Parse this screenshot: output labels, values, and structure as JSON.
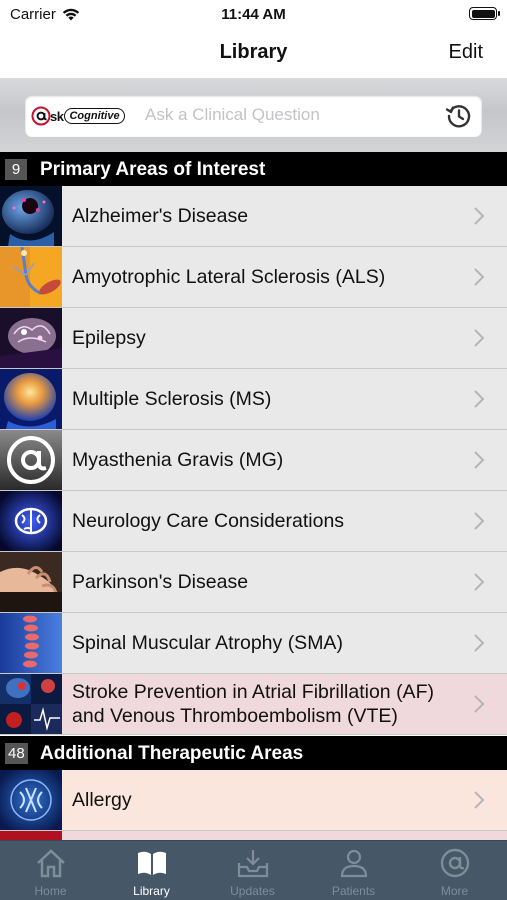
{
  "status_bar": {
    "carrier": "Carrier",
    "time": "11:44 AM"
  },
  "nav": {
    "title": "Library",
    "edit_label": "Edit"
  },
  "search": {
    "logo_ask": "sk",
    "logo_cognitive": "Cognitive",
    "placeholder": "Ask a Clinical Question"
  },
  "sections": [
    {
      "count": "9",
      "title": "Primary Areas of Interest",
      "items": [
        {
          "label": "Alzheimer's Disease",
          "icon": "alzheimers-thumbnail"
        },
        {
          "label": "Amyotrophic Lateral Sclerosis (ALS)",
          "icon": "als-thumbnail"
        },
        {
          "label": "Epilepsy",
          "icon": "epilepsy-thumbnail"
        },
        {
          "label": "Multiple Sclerosis (MS)",
          "icon": "ms-thumbnail"
        },
        {
          "label": "Myasthenia Gravis (MG)",
          "icon": "mg-at-logo-thumbnail"
        },
        {
          "label": "Neurology Care Considerations",
          "icon": "brain-thumbnail"
        },
        {
          "label": "Parkinson's Disease",
          "icon": "parkinsons-hand-thumbnail"
        },
        {
          "label": "Spinal Muscular Atrophy (SMA)",
          "icon": "spine-thumbnail"
        },
        {
          "label": "Stroke Prevention in Atrial Fibrillation (AF) and Venous Thromboembolism (VTE)",
          "icon": "stroke-thumbnail"
        }
      ]
    },
    {
      "count": "48",
      "title": "Additional Therapeutic Areas",
      "items": [
        {
          "label": "Allergy",
          "icon": "allergy-thumbnail"
        }
      ]
    }
  ],
  "colors": {
    "row_gray": "#e9e9e9",
    "row_pink": "#efd9dc",
    "row_peach": "#fbe6de",
    "tab_bar": "#465868",
    "section_header": "#000000"
  },
  "tabs": [
    {
      "label": "Home",
      "icon": "home-icon",
      "active": false
    },
    {
      "label": "Library",
      "icon": "book-icon",
      "active": true
    },
    {
      "label": "Updates",
      "icon": "inbox-download-icon",
      "active": false
    },
    {
      "label": "Patients",
      "icon": "person-icon",
      "active": false
    },
    {
      "label": "More",
      "icon": "at-icon",
      "active": false
    }
  ]
}
